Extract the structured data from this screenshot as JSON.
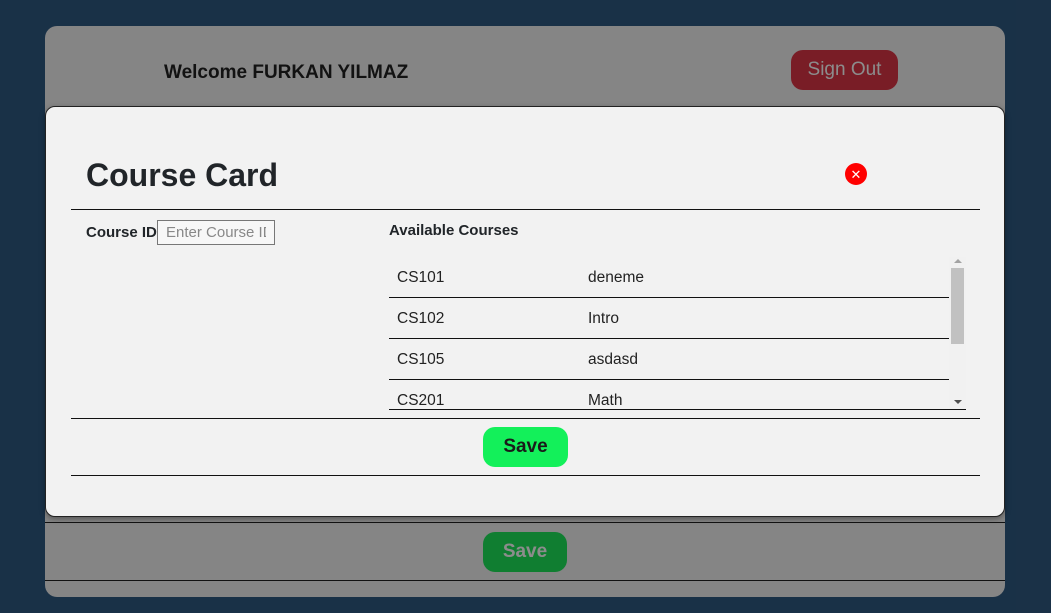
{
  "page": {
    "welcome_text": "Welcome FURKAN YILMAZ",
    "sign_out_label": "Sign Out",
    "background_save_label": "Save"
  },
  "modal": {
    "title": "Course Card",
    "close_icon": "close-icon",
    "course_id_label": "Course ID",
    "course_id_placeholder": "Enter Course ID",
    "course_id_value": "",
    "available_courses_title": "Available Courses",
    "courses": [
      {
        "code": "CS101",
        "name": "deneme"
      },
      {
        "code": "CS102",
        "name": "Intro"
      },
      {
        "code": "CS105",
        "name": "asdasd"
      },
      {
        "code": "CS201",
        "name": "Math"
      }
    ],
    "save_label": "Save"
  },
  "colors": {
    "page_background": "#2f5a82",
    "card_background": "#f2f2f2",
    "sign_out_button": "#dc3545",
    "save_button": "#13f05a",
    "close_button": "#ff0000"
  }
}
